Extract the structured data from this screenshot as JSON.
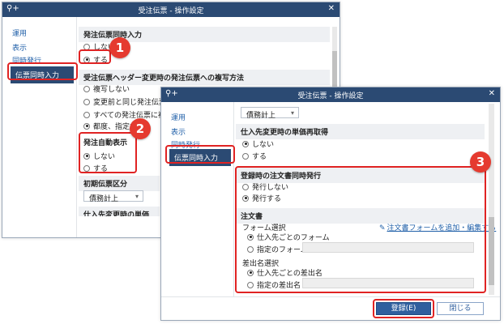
{
  "back_window": {
    "title": "受注伝票 - 操作設定",
    "sidebar": [
      "運用",
      "表示",
      "同時発行",
      "伝票同時入力"
    ],
    "sections": {
      "simultaneous_input": {
        "title": "発注伝票同時入力",
        "options": [
          "しない",
          "する"
        ]
      },
      "copy_method": {
        "title": "受注伝票ヘッダー変更時の発注伝票への複写方法",
        "options": [
          "複写しない",
          "変更前と同じ発注伝票に複",
          "すべての発注伝票に複写",
          "都度、指定する"
        ]
      },
      "auto_display": {
        "title": "発注自動表示",
        "options": [
          "しない",
          "する"
        ]
      },
      "initial_class": {
        "title": "初期伝票区分",
        "value": "債務計上"
      },
      "cut_title": "仕入先変更時の単価再取得"
    }
  },
  "front_window": {
    "title": "受注伝票 - 操作設定",
    "sidebar": [
      "運用",
      "表示",
      "同時発行",
      "伝票同時入力"
    ],
    "top_select": "債務計上",
    "price_refetch": {
      "title": "仕入先変更時の単価再取得",
      "options": [
        "しない",
        "する"
      ]
    },
    "register_issue": {
      "title": "登録時の注文書同時発行",
      "options": [
        "発行しない",
        "発行する"
      ]
    },
    "order_form": {
      "title": "注文書",
      "form_select_label": "フォーム選択",
      "add_edit_link": "注文書フォームを追加・編集する",
      "form_options": [
        "仕入先ごとのフォーム",
        "指定のフォーム"
      ],
      "sender_label": "差出名選択",
      "sender_options": [
        "仕入先ごとの差出名",
        "指定の差出名"
      ]
    },
    "buttons": {
      "register": "登録(E)",
      "close": "閉じる"
    }
  },
  "badges": [
    "1",
    "2",
    "3"
  ],
  "icons": {
    "app": "search-plus-icon",
    "close": "close-icon",
    "edit": "edit-icon",
    "caret": "chevron-down-icon"
  }
}
